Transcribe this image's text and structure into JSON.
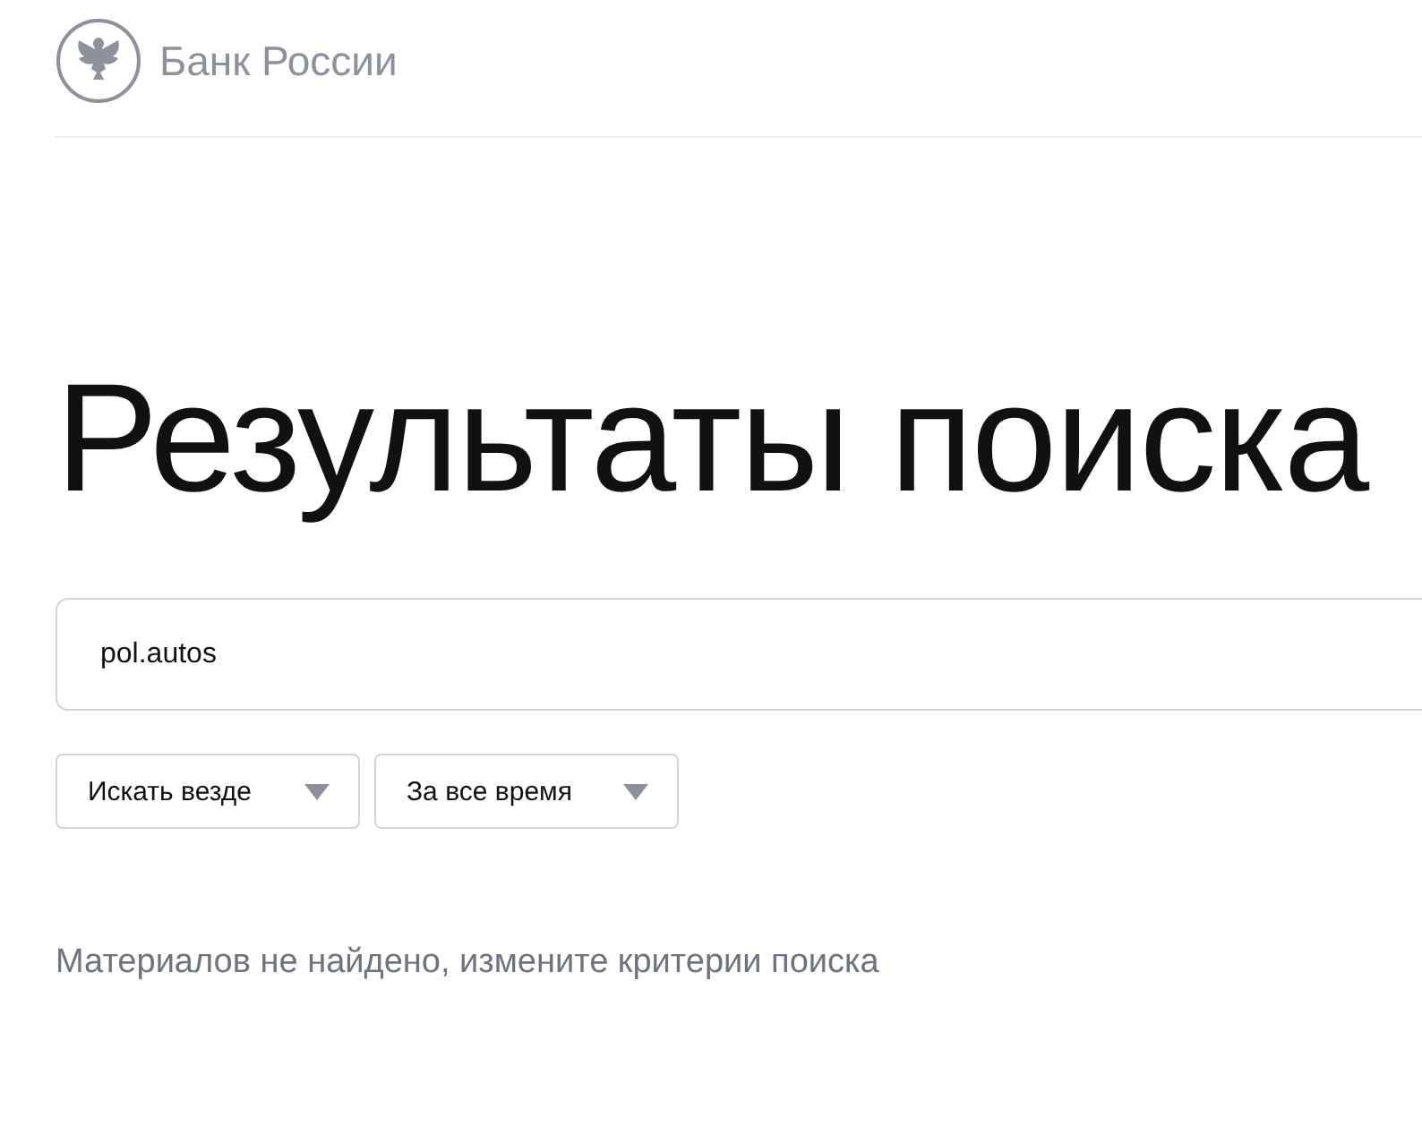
{
  "header": {
    "brand": "Банк России"
  },
  "title": "Результаты поиска",
  "search": {
    "value": "pol.autos"
  },
  "filters": [
    {
      "label": "Искать везде"
    },
    {
      "label": "За все время"
    }
  ],
  "message": "Материалов не найдено, измените критерии поиска"
}
